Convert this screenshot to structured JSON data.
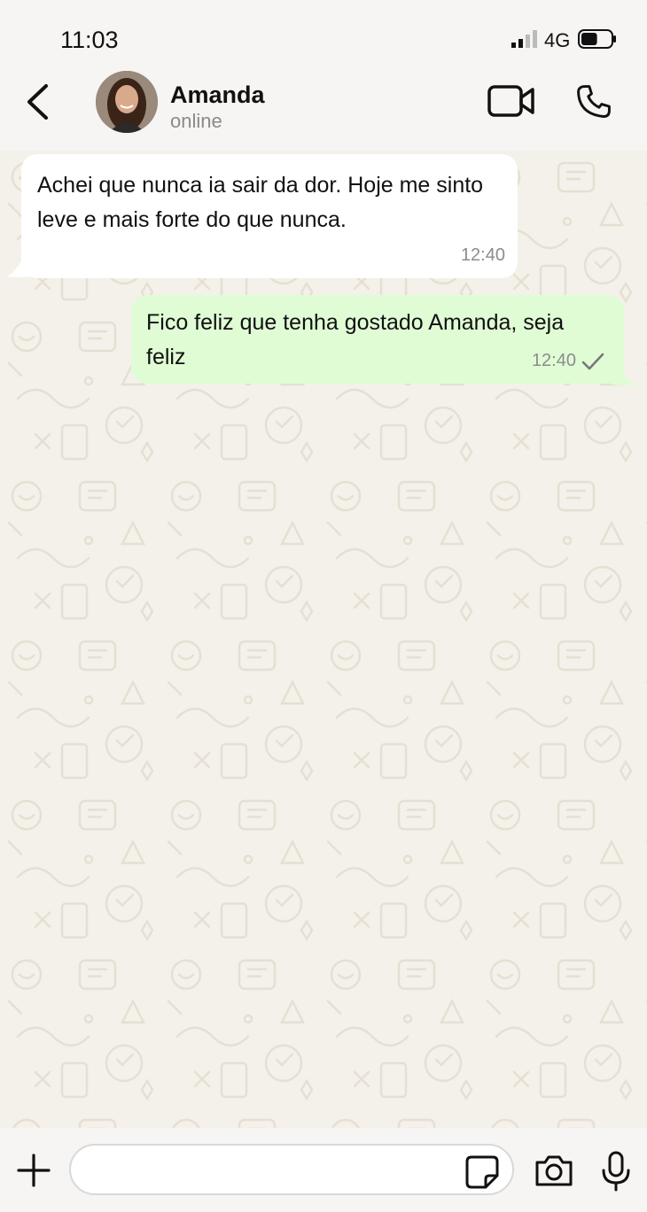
{
  "status_bar": {
    "time": "11:03",
    "network": "4G",
    "battery_level": 0.55
  },
  "header": {
    "contact_name": "Amanda",
    "contact_status": "online",
    "icons": {
      "back": "chevron-left-icon",
      "video": "video-camera-icon",
      "call": "phone-icon"
    }
  },
  "messages": [
    {
      "direction": "incoming",
      "text": "Achei que nunca ia sair da dor. Hoje me sinto leve e mais forte do que nunca.",
      "time": "12:40"
    },
    {
      "direction": "outgoing",
      "text": "Fico feliz que tenha gostado Amanda, seja feliz",
      "time": "12:40",
      "status": "sent"
    }
  ],
  "composer": {
    "placeholder": "",
    "value": "",
    "icons": {
      "plus": "plus-icon",
      "sticker": "sticker-icon",
      "camera": "camera-icon",
      "mic": "microphone-icon"
    }
  },
  "colors": {
    "incoming_bubble": "#ffffff",
    "outgoing_bubble": "#e0fcd5",
    "chat_background": "#f4f1ea",
    "bar_background": "#f6f5f3"
  }
}
